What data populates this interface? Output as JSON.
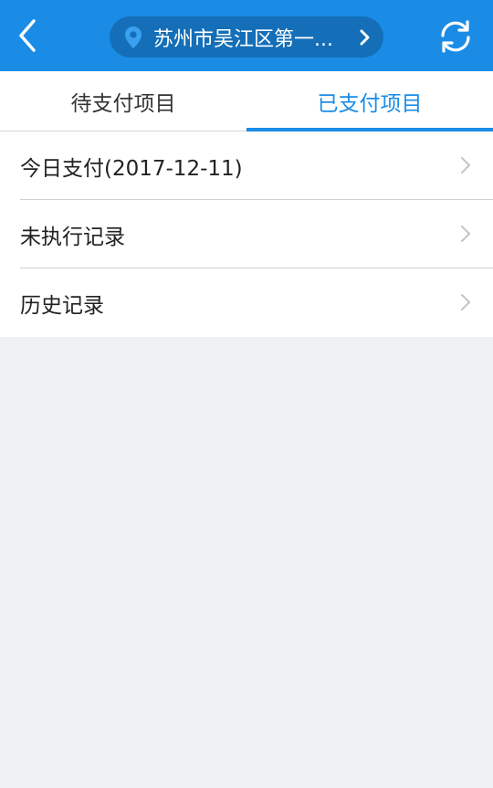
{
  "header": {
    "location": "苏州市吴江区第一...",
    "back_icon": "chevron-left-icon",
    "pin_icon": "location-pin-icon",
    "refresh_icon": "refresh-icon",
    "bar_color": "#1a8ce6",
    "pill_color": "#146fb8"
  },
  "tabs": [
    {
      "label": "待支付项目",
      "active": false
    },
    {
      "label": "已支付项目",
      "active": true
    }
  ],
  "list": [
    {
      "label": "今日支付(2017-12-11)"
    },
    {
      "label": "未执行记录"
    },
    {
      "label": "历史记录"
    }
  ],
  "colors": {
    "accent": "#1a8ce6",
    "background": "#eef0f2"
  }
}
